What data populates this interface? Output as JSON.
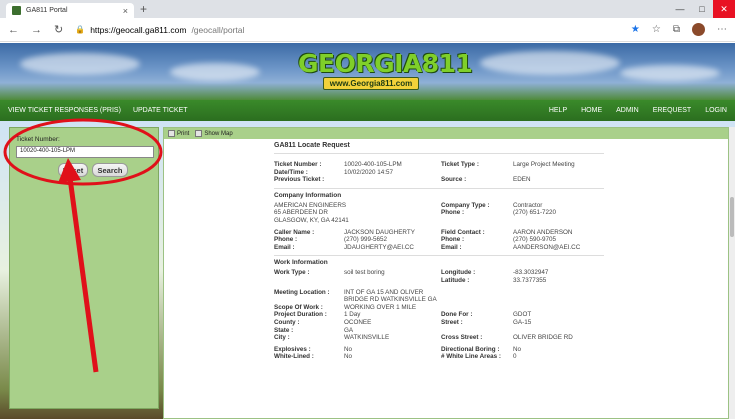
{
  "browser": {
    "tab_title": "GA811 Portal",
    "tab_close": "×",
    "new_tab": "+",
    "url_domain": "https://geocall.ga811.com",
    "url_path": "/geocall/portal"
  },
  "logo": {
    "line1": "GEORGIA811",
    "line2": "www.Georgia811.com"
  },
  "menu": {
    "left": [
      "VIEW TICKET RESPONSES (PRIS)",
      "UPDATE TICKET"
    ],
    "right": [
      "HELP",
      "HOME",
      "ADMIN",
      "EREQUEST",
      "LOGIN"
    ]
  },
  "sidebar": {
    "label": "Ticket Number:",
    "ticket_value": "10020-400-105-LPM",
    "reset_label": "Reset",
    "search_label": "Search"
  },
  "toolbar": {
    "print": "Print",
    "show_map": "Show Map"
  },
  "doc": {
    "title": "GA811 Locate Request",
    "ticket": {
      "ticket_number_k": "Ticket Number :",
      "ticket_number_v": "10020-400-105-LPM",
      "ticket_type_k": "Ticket Type :",
      "ticket_type_v": "Large Project Meeting",
      "datetime_k": "Date/Time :",
      "datetime_v": "10/02/2020 14:57",
      "prev_k": "Previous Ticket :",
      "prev_v": "",
      "source_k": "Source :",
      "source_v": "EDEN"
    },
    "company": {
      "title": "Company Information",
      "name": "AMERICAN ENGINEERS",
      "addr1": "65 ABERDEEN DR",
      "addr2": "GLASGOW, KY, GA 42141",
      "type_k": "Company Type :",
      "type_v": "Contractor",
      "phone_k": "Phone :",
      "phone_v": "(270) 651-7220",
      "caller_k": "Caller Name :",
      "caller_v": "JACKSON DAUGHERTY",
      "cphone_k": "Phone :",
      "cphone_v": "(270) 999-5652",
      "email_k": "Email :",
      "email_v": "JDAUGHERTY@AEI.CC",
      "field_k": "Field Contact :",
      "field_v": "AARON ANDERSON",
      "fphone_k": "Phone :",
      "fphone_v": "(270) 590-9705",
      "femail_k": "Email :",
      "femail_v": "AANDERSON@AEI.CC"
    },
    "work": {
      "title": "Work Information",
      "type_k": "Work Type :",
      "type_v": "soil test boring",
      "long_k": "Longitude :",
      "long_v": "-83.3032947",
      "lat_k": "Latitude :",
      "lat_v": "33.7377355",
      "meet_k": "Meeting Location :",
      "meet_v1": "INT OF GA 15 AND OLIVER",
      "meet_v2": "BRIDGE RD WATKINSVILLE GA",
      "scope_k": "Scope Of Work :",
      "scope_v": "WORKING OVER 1 MILE",
      "dur_k": "Project Duration :",
      "dur_v": "1 Day",
      "done_k": "Done For :",
      "done_v": "GDOT",
      "county_k": "County :",
      "county_v": "OCONEE",
      "street_k": "Street :",
      "street_v": "GA-15",
      "state_k": "State :",
      "state_v": "GA",
      "city_k": "City :",
      "city_v": "WATKINSVILLE",
      "cross_k": "Cross Street :",
      "cross_v": "OLIVER BRIDGE RD",
      "expl_k": "Explosives :",
      "expl_v": "No",
      "dir_k": "Directional Boring :",
      "dir_v": "No",
      "white_k": "White-Lined :",
      "white_v": "No",
      "wla_k": "# White Line Areas :",
      "wla_v": "0"
    }
  },
  "colors": {
    "menubar": "#2b6e1f",
    "sidebar": "#a9d08a",
    "annotation": "#e0101a"
  }
}
